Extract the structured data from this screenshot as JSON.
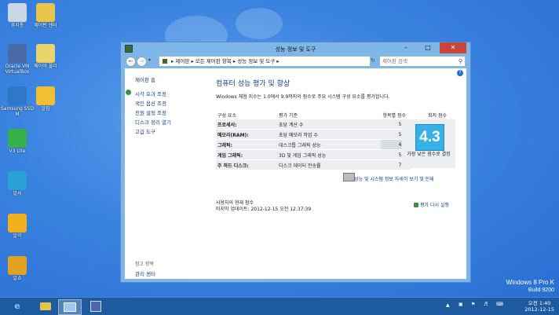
{
  "desktop": {
    "icons": [
      {
        "label": "휴지통",
        "color": "#c9d6e6"
      },
      {
        "label": "제어판 센터",
        "color": "#e8c44a"
      },
      {
        "label": "Oracle VM VirtualBox",
        "color": "#4a6aa8"
      },
      {
        "label": "메이아 폴더",
        "color": "#e9d36a"
      },
      {
        "label": "Samsung SSD M",
        "color": "#2f78c8"
      },
      {
        "label": "알집",
        "color": "#f0c030"
      },
      {
        "label": "V3 Lite",
        "color": "#36b04a"
      },
      {
        "label": "알씨",
        "color": "#2aa0d8"
      },
      {
        "label": "알약",
        "color": "#f0b020"
      },
      {
        "label": "알쇼",
        "color": "#e0a020"
      }
    ],
    "watermark": {
      "line1": "Windows 8 Pro K",
      "line2": "Build 9200"
    }
  },
  "window": {
    "title": "성능 정보 및 도구",
    "address": {
      "crumbs": [
        "제어판",
        "모든 제어판 항목",
        "성능 정보 및 도구"
      ],
      "separator": "▸"
    },
    "search_placeholder": "제어판 검색",
    "nav": {
      "home": "제어판 홈",
      "links": [
        "시각 효과 조정",
        "색인 옵션 조정",
        "전원 설정 조정",
        "디스크 정리 열기",
        "고급 도구"
      ],
      "see_also_title": "참고 항목",
      "see_also_links": [
        "관리 센터"
      ]
    },
    "main": {
      "heading": "컴퓨터 성능 평가 및 향상",
      "description": "Windows 체험 지수는 1.0에서 9.9까지의 점수로 주요 시스템 구성 요소를 평가합니다.",
      "table": {
        "headers": [
          "구성 요소",
          "평가 기준",
          "항목별 점수",
          "최저 점수"
        ],
        "rows": [
          {
            "component": "프로세서:",
            "criteria": "초당 계산 수",
            "score": "5.4"
          },
          {
            "component": "메모리(RAM):",
            "criteria": "초당 메모리 작업 수",
            "score": "5.9"
          },
          {
            "component": "그래픽:",
            "criteria": "데스크톱 그래픽 성능",
            "score": "4.3"
          },
          {
            "component": "게임 그래픽:",
            "criteria": "3D 및 게임 그래픽 성능",
            "score": "5.6"
          },
          {
            "component": "주 하드 디스크:",
            "criteria": "디스크 데이터 전송률",
            "score": "7.7"
          }
        ]
      },
      "base_score": "4.3",
      "base_score_caption": "가장 낮은 점수로 결정",
      "details_link": "성능 및 시스템 정보 자세히 보기 및 인쇄",
      "current_score_label": "사용자의 현재 점수",
      "last_update": "마지막 업데이트: 2012-12-15 오전 12:37:39",
      "rerun_label": "평가 다시 실행"
    }
  },
  "taskbar": {
    "clock_time": "오전 1:40",
    "clock_date": "2012-12-15"
  }
}
